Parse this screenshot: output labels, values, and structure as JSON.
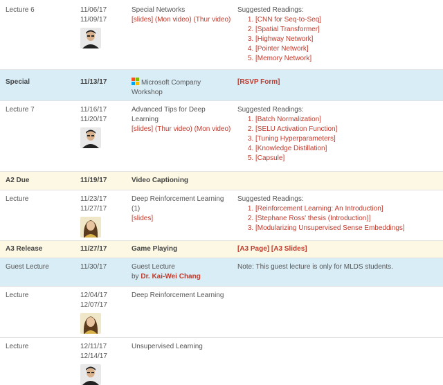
{
  "rows": [
    {
      "type": "Lecture 6",
      "dates": [
        "11/06/17",
        "11/09/17"
      ],
      "topic": "Special Networks",
      "links": "[slides] (Mon video) (Thur video)",
      "readings_title": "Suggested Readings:",
      "readings": [
        "[CNN for Seq-to-Seq]",
        "[Spatial Transformer]",
        "[Highway Network]",
        "[Pointer Network]",
        "[Memory Network]"
      ],
      "avatar": "male-instructor"
    },
    {
      "type": "Special",
      "dates": [
        "11/13/17"
      ],
      "topic": "Microsoft Company Workshop",
      "readings_link": "[RSVP Form]",
      "icon": "microsoft-logo-icon"
    },
    {
      "type": "Lecture 7",
      "dates": [
        "11/16/17",
        "11/20/17"
      ],
      "topic": "Advanced Tips for Deep Learning",
      "links": "[slides] (Thur video) (Mon video)",
      "readings_title": "Suggested Readings:",
      "readings": [
        "[Batch Normalization]",
        "[SELU Activation Function]",
        "[Tuning Hyperparameters]",
        "[Knowledge Distillation]",
        "[Capsule]"
      ],
      "avatar": "male-instructor"
    },
    {
      "type": "A2 Due",
      "dates": [
        "11/19/17"
      ],
      "topic": "Video Captioning"
    },
    {
      "type": "Lecture",
      "dates": [
        "11/23/17",
        "11/27/17"
      ],
      "topic": "Deep Reinforcement Learning (1)",
      "links": "[slides]",
      "readings_title": "Suggested Readings:",
      "readings": [
        "[Reinforcement Learning: An Introduction]",
        "[Stephane Ross' thesis (Introduction)]",
        "[Modularizing Unsupervised Sense Embeddings]"
      ],
      "avatar": "female-instructor"
    },
    {
      "type": "A3 Release",
      "dates": [
        "11/27/17"
      ],
      "topic": "Game Playing",
      "readings_link": "[A3 Page] [A3 Slides]"
    },
    {
      "type": "Guest Lecture",
      "dates": [
        "11/30/17"
      ],
      "topic": "Guest Lecture",
      "by": "by",
      "speaker": "Dr. Kai-Wei Chang",
      "note": "Note: This guest lecture is only for MLDS students."
    },
    {
      "type": "Lecture",
      "dates": [
        "12/04/17",
        "12/07/17"
      ],
      "topic": "Deep Reinforcement Learning",
      "avatar": "female-instructor"
    },
    {
      "type": "Lecture",
      "dates": [
        "12/11/17",
        "12/14/17"
      ],
      "topic": "Unsupervised Learning",
      "avatar": "male-instructor"
    }
  ],
  "colors": {
    "link": "#c0392b",
    "highlight_blue": "#d9edf7",
    "highlight_yellow": "#fcf8e3"
  }
}
